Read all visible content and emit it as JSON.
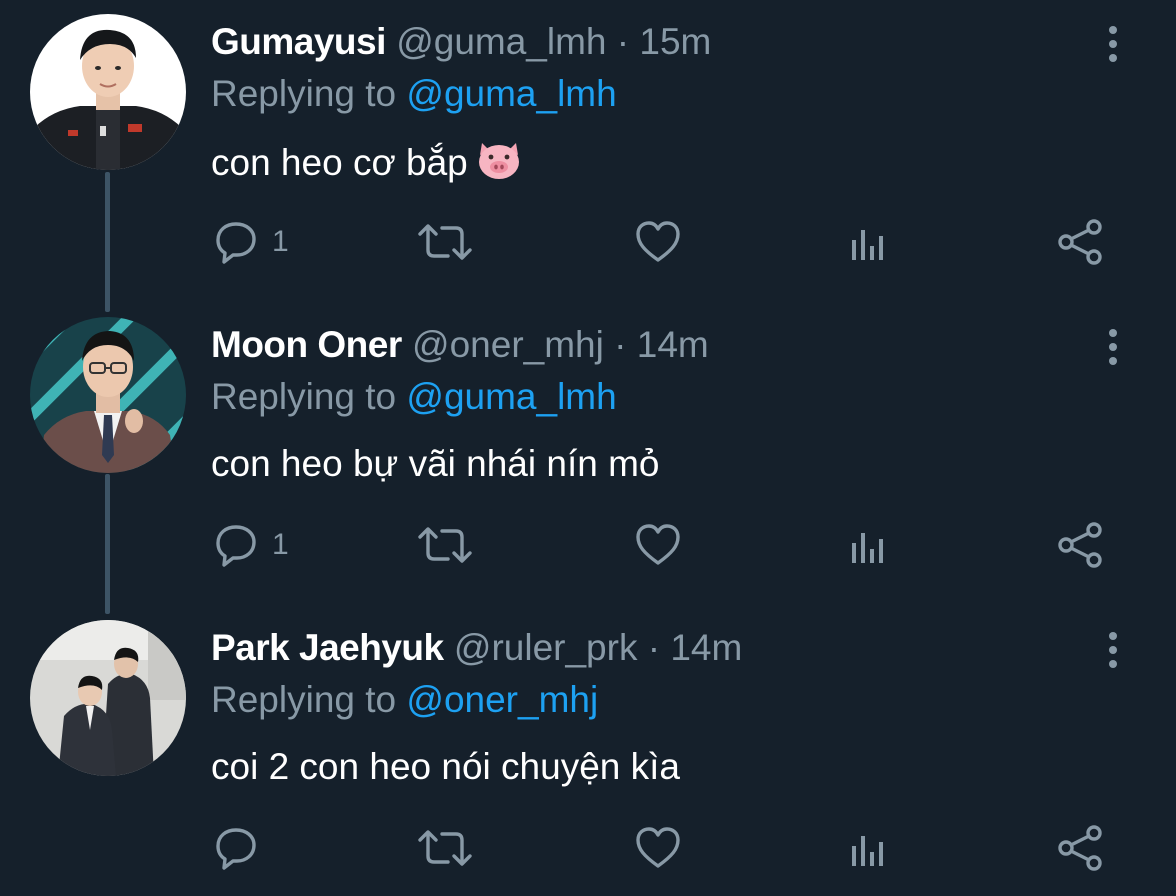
{
  "tweets": [
    {
      "display_name": "Gumayusi",
      "handle": "@guma_lmh",
      "separator": "·",
      "time": "15m",
      "replying_prefix": "Replying to",
      "replying_to": "@guma_lmh",
      "text": "con heo cơ bắp",
      "emoji": "pig-face",
      "reply_count": "1",
      "avatar": "avatar-photo-player-in-team-jacket"
    },
    {
      "display_name": "Moon Oner",
      "handle": "@oner_mhj",
      "separator": "·",
      "time": "14m",
      "replying_prefix": "Replying to",
      "replying_to": "@guma_lmh",
      "text": "con heo bự vãi nhái nín mỏ",
      "reply_count": "1",
      "avatar": "avatar-photo-player-in-suit"
    },
    {
      "display_name": "Park Jaehyuk",
      "handle": "@ruler_prk",
      "separator": "·",
      "time": "14m",
      "replying_prefix": "Replying to",
      "replying_to": "@oner_mhj",
      "text": "coi 2 con heo nói chuyện kìa",
      "reply_count": "",
      "avatar": "avatar-photo-two-people-walking"
    }
  ],
  "icons": {
    "reply": "speech-bubble-icon",
    "retweet": "retweet-arrows-icon",
    "like": "heart-icon",
    "analytics": "bar-chart-icon",
    "share": "share-nodes-icon",
    "more": "vertical-dots-icon"
  },
  "colors": {
    "background": "#15202b",
    "secondary_text": "#8899a6",
    "mention": "#1da1f2",
    "thread_line": "#3d5466"
  }
}
